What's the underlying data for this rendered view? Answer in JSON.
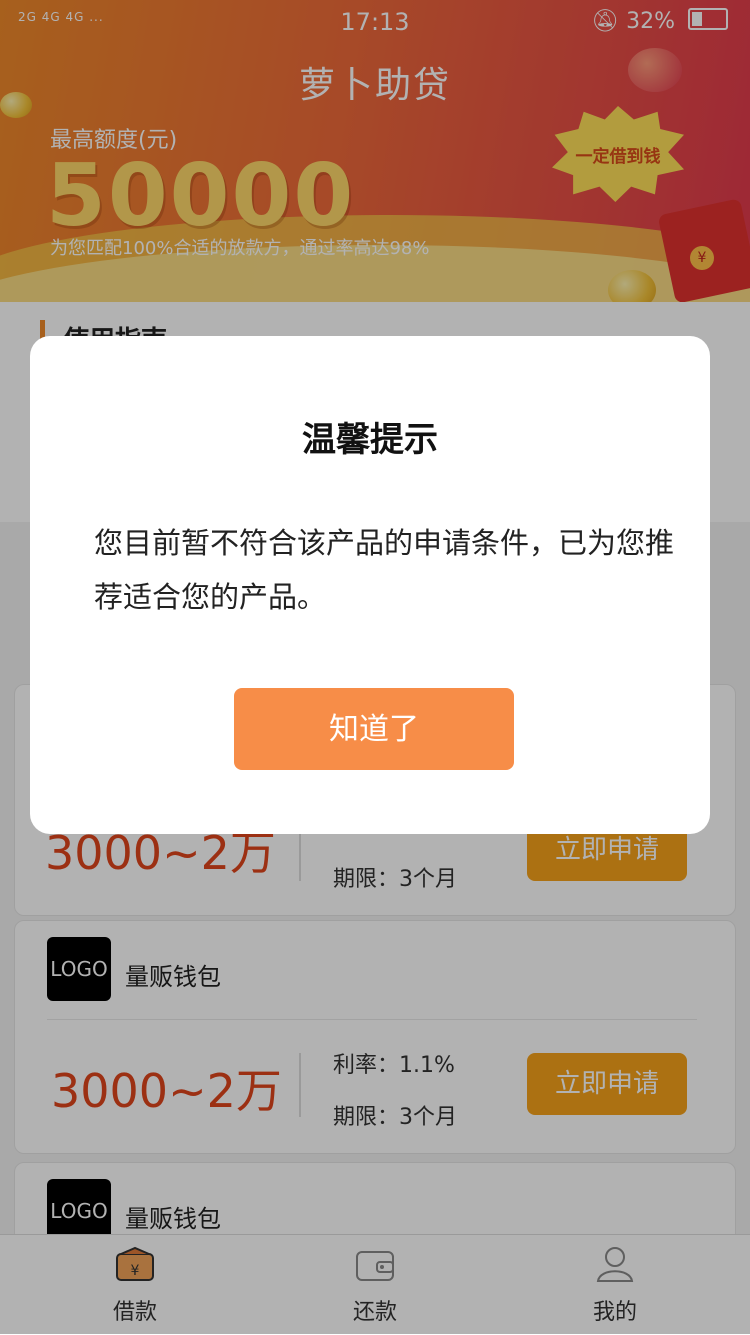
{
  "status_bar": {
    "signal": "2G 4G 4G ...",
    "time": "17:13",
    "battery": "32%"
  },
  "header": {
    "title": "萝卜助贷",
    "limit_label": "最高额度(元)",
    "limit_value": "50000",
    "subtitle": "为您匹配100%合适的放款方，通过率高达98%",
    "badge": "一定借到钱",
    "envelope_seal": "¥"
  },
  "guide": {
    "title": "使用指南"
  },
  "products": [
    {
      "amount": "3000~2万",
      "term": "期限：3个月",
      "apply_label": "立即申请"
    },
    {
      "logo": "LOGO",
      "name": "量贩钱包",
      "amount": "3000~2万",
      "rate": "利率：1.1%",
      "term": "期限：3个月",
      "apply_label": "立即申请"
    },
    {
      "logo": "LOGO",
      "name": "量贩钱包"
    }
  ],
  "tabs": [
    {
      "label": "借款",
      "icon": "wallet-yen-icon",
      "active": true
    },
    {
      "label": "还款",
      "icon": "wallet-icon",
      "active": false
    },
    {
      "label": "我的",
      "icon": "user-icon",
      "active": false
    }
  ],
  "dialog": {
    "title": "温馨提示",
    "message": "您目前暂不符合该产品的申请条件，已为您推荐适合您的产品。",
    "button_label": "知道了"
  },
  "colors": {
    "accent": "#f78d48",
    "apply": "#f6a21b",
    "amount": "#e0451c"
  }
}
